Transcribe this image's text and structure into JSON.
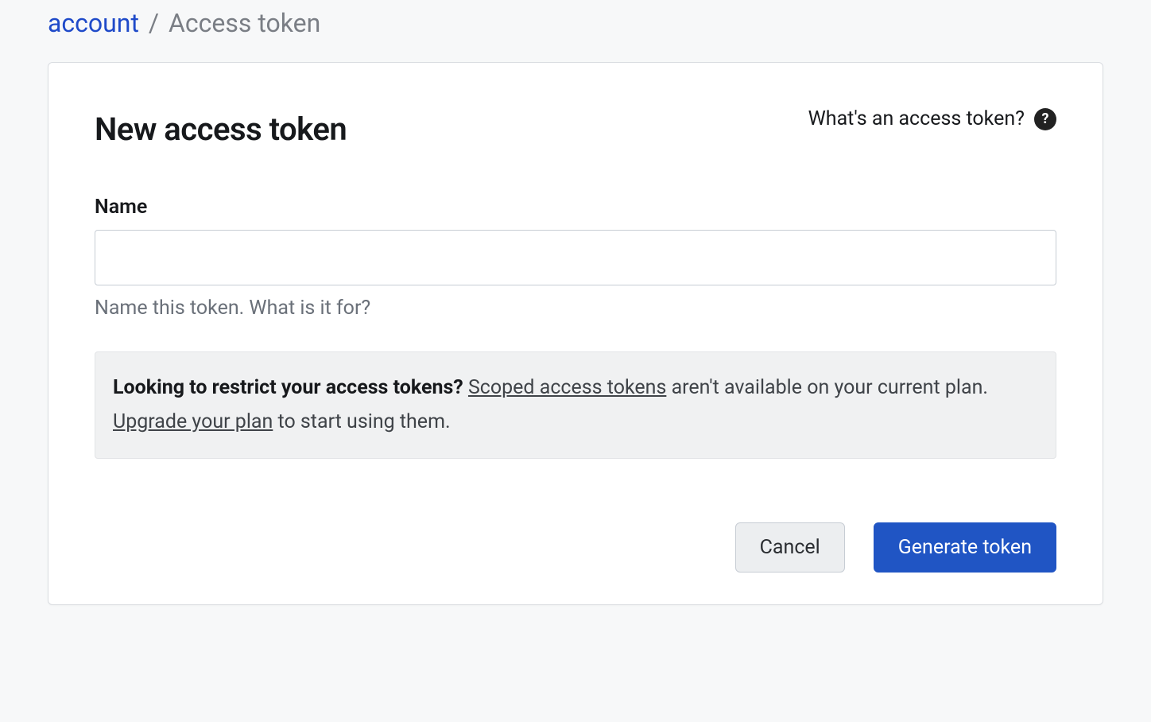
{
  "breadcrumb": {
    "link_label": "account",
    "separator": "/",
    "current": "Access token"
  },
  "card": {
    "title": "New access token",
    "help_label": "What's an access token?",
    "help_icon_char": "?"
  },
  "form": {
    "name_label": "Name",
    "name_value": "",
    "name_hint": "Name this token. What is it for?"
  },
  "notice": {
    "bold": "Looking to restrict your access tokens?",
    "link1": "Scoped access tokens",
    "text1": " aren't available on your current plan. ",
    "link2": "Upgrade your plan",
    "text2": " to start using them."
  },
  "buttons": {
    "cancel": "Cancel",
    "generate": "Generate token"
  }
}
